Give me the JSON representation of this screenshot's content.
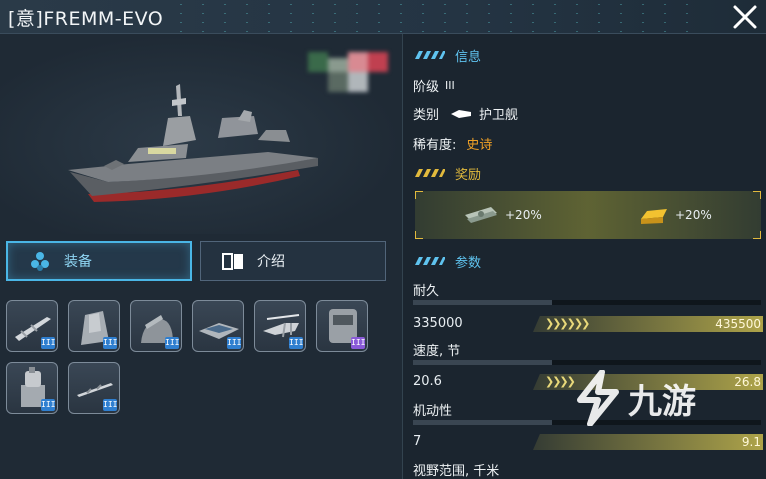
{
  "header": {
    "title": "[意]FREMM-EVO"
  },
  "tabs": [
    {
      "label": "装备",
      "icon": "equipment-icon",
      "active": true
    },
    {
      "label": "介绍",
      "icon": "book-icon",
      "active": false
    }
  ],
  "equipment_slots": [
    {
      "icon": "missile-icon",
      "tier": "III",
      "rarity": "blue"
    },
    {
      "icon": "gun-turret-icon",
      "tier": "III",
      "rarity": "blue"
    },
    {
      "icon": "deck-gun-icon",
      "tier": "III",
      "rarity": "blue"
    },
    {
      "icon": "launcher-icon",
      "tier": "III",
      "rarity": "blue"
    },
    {
      "icon": "helicopter-icon",
      "tier": "III",
      "rarity": "blue"
    },
    {
      "icon": "radar-module-icon",
      "tier": "III",
      "rarity": "purple"
    },
    {
      "icon": "ciws-icon",
      "tier": "III",
      "rarity": "blue"
    },
    {
      "icon": "torpedo-icon",
      "tier": "III",
      "rarity": "blue"
    }
  ],
  "info": {
    "section_title": "信息",
    "tier_label": "阶级",
    "tier_value": "III",
    "type_label": "类别",
    "type_value": "护卫舰",
    "rarity_label": "稀有度:",
    "rarity_value": "史诗"
  },
  "rewards": {
    "section_title": "奖励",
    "items": [
      {
        "icon": "cash-icon",
        "value": "+20%"
      },
      {
        "icon": "gold-bar-icon",
        "value": "+20%"
      }
    ]
  },
  "params": {
    "section_title": "参数",
    "stats": [
      {
        "label": "耐久",
        "current": "335000",
        "max": "435500"
      },
      {
        "label": "速度, 节",
        "current": "20.6",
        "max": "26.8"
      },
      {
        "label": "机动性",
        "current": "7",
        "max": "9.1"
      },
      {
        "label": "视野范围, 千米",
        "current": "",
        "max": ""
      }
    ]
  },
  "watermark": {
    "text": "九游"
  },
  "colors": {
    "accent_blue": "#4ab6e6",
    "gold": "#e2ba3d",
    "epic_orange": "#f0a126",
    "rarity_blue": "#2f7fd0",
    "rarity_purple": "#8a5ad8"
  }
}
